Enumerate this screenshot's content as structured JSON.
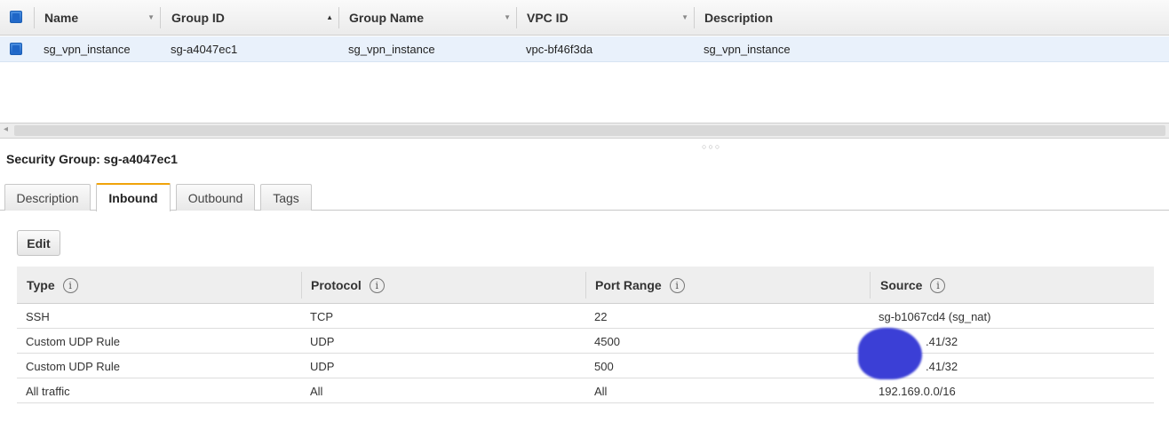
{
  "grid": {
    "columns": [
      "Name",
      "Group ID",
      "Group Name",
      "VPC ID",
      "Description"
    ],
    "row": {
      "name": "sg_vpn_instance",
      "group_id": "sg-a4047ec1",
      "group_name": "sg_vpn_instance",
      "vpc_id": "vpc-bf46f3da",
      "description": "sg_vpn_instance"
    }
  },
  "details": {
    "title": "Security Group: sg-a4047ec1",
    "tabs": [
      "Description",
      "Inbound",
      "Outbound",
      "Tags"
    ],
    "active_tab": "Inbound",
    "edit_label": "Edit",
    "columns": [
      "Type",
      "Protocol",
      "Port Range",
      "Source"
    ],
    "rules": [
      {
        "type": "SSH",
        "protocol": "TCP",
        "port_range": "22",
        "source": "sg-b1067cd4 (sg_nat)"
      },
      {
        "type": "Custom UDP Rule",
        "protocol": "UDP",
        "port_range": "4500",
        "source": ".41/32"
      },
      {
        "type": "Custom UDP Rule",
        "protocol": "UDP",
        "port_range": "500",
        "source": ".41/32"
      },
      {
        "type": "All traffic",
        "protocol": "All",
        "port_range": "All",
        "source": "192.169.0.0/16"
      }
    ]
  },
  "colors": {
    "accent_tab": "#f0a30a",
    "checkbox": "#1f66c7",
    "selected_row": "#e9f1fb"
  }
}
